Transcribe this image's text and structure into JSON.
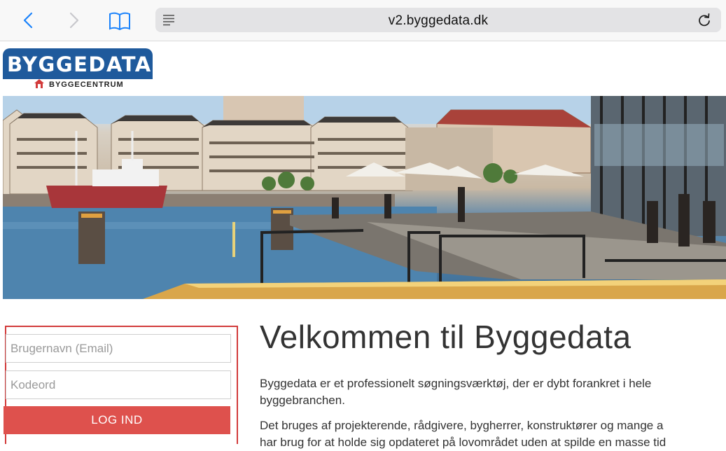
{
  "browser": {
    "url": "v2.byggedata.dk",
    "icons": [
      "chevron-left-icon",
      "chevron-right-icon",
      "book-icon",
      "reader-icon",
      "reload-icon"
    ]
  },
  "logo": {
    "main_text": "BYGGEDATA",
    "sub_text": "BYGGECENTRUM",
    "brand_color": "#1f5a9c",
    "accent_color": "#d23b3b"
  },
  "login": {
    "username_placeholder": "Brugernavn (Email)",
    "password_placeholder": "Kodeord",
    "submit_label": "LOG IND",
    "button_color": "#de514d"
  },
  "content": {
    "title": "Velkommen til Byggedata",
    "paragraph1": "Byggedata er et professionelt søgningsværktøj, der er dybt forankret i hele byggebranchen.",
    "paragraph2_line1": "Det bruges af projekterende, rådgivere, bygherrer, konstruktører og mange a",
    "paragraph2_line2": "har brug for at holde sig opdateret på lovområdet uden at spilde en masse tid"
  }
}
